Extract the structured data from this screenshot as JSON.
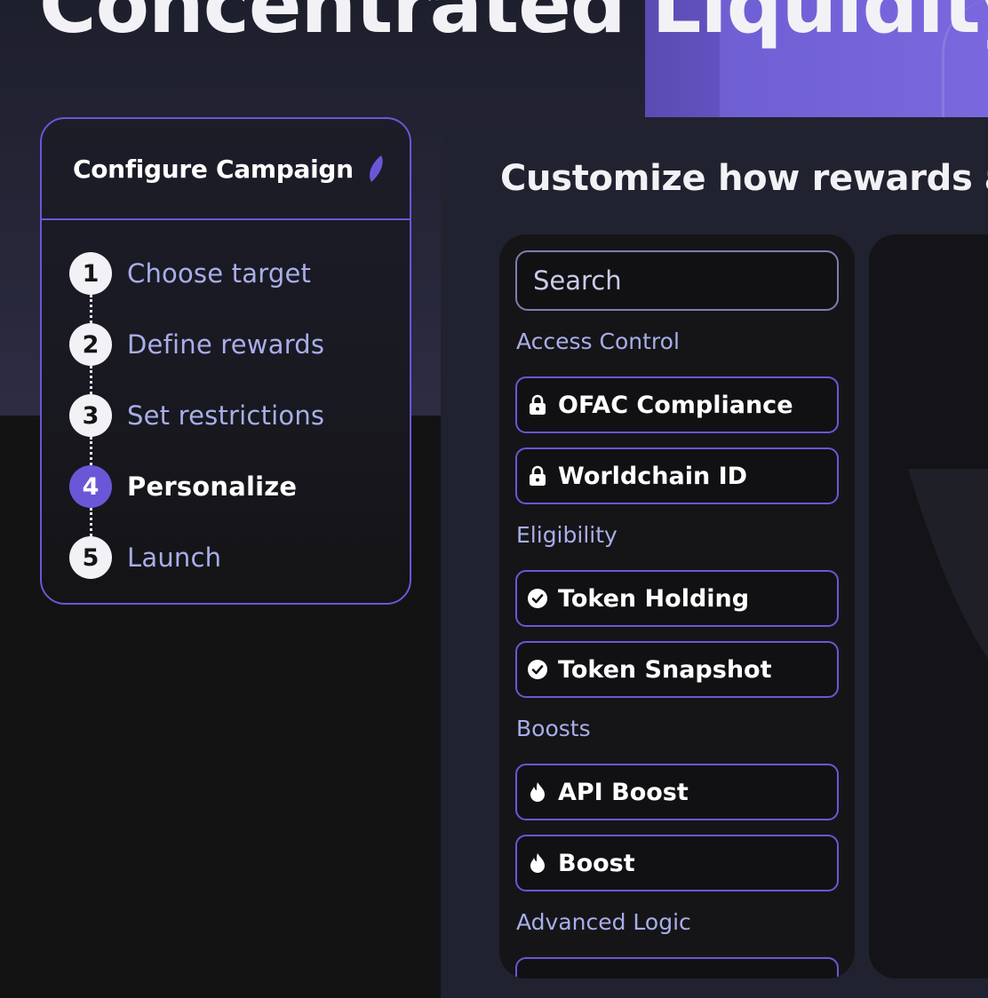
{
  "hero": {
    "title": "Concentrated Liquidity"
  },
  "stepper": {
    "title": "Configure Campaign",
    "steps": [
      {
        "number": "1",
        "label": "Choose target"
      },
      {
        "number": "2",
        "label": "Define rewards"
      },
      {
        "number": "3",
        "label": "Set restrictions"
      },
      {
        "number": "4",
        "label": "Personalize"
      },
      {
        "number": "5",
        "label": "Launch"
      }
    ],
    "active_step": 4
  },
  "main": {
    "heading": "Customize how rewards are",
    "search": {
      "placeholder": "Search",
      "value": ""
    },
    "sections": [
      {
        "label": "Access Control",
        "items": [
          {
            "label": "OFAC Compliance",
            "icon": "lock-icon"
          },
          {
            "label": "Worldchain ID",
            "icon": "lock-icon"
          }
        ]
      },
      {
        "label": "Eligibility",
        "items": [
          {
            "label": "Token Holding",
            "icon": "check-circle-icon"
          },
          {
            "label": "Token Snapshot",
            "icon": "check-circle-icon"
          }
        ]
      },
      {
        "label": "Boosts",
        "items": [
          {
            "label": "API Boost",
            "icon": "flame-icon"
          },
          {
            "label": "Boost",
            "icon": "flame-icon"
          }
        ]
      },
      {
        "label": "Advanced Logic",
        "items": []
      }
    ]
  },
  "colors": {
    "accent": "#6a57d8",
    "accent_text": "#a8aee8",
    "panel": "#21222f",
    "list_bg": "#151518"
  }
}
